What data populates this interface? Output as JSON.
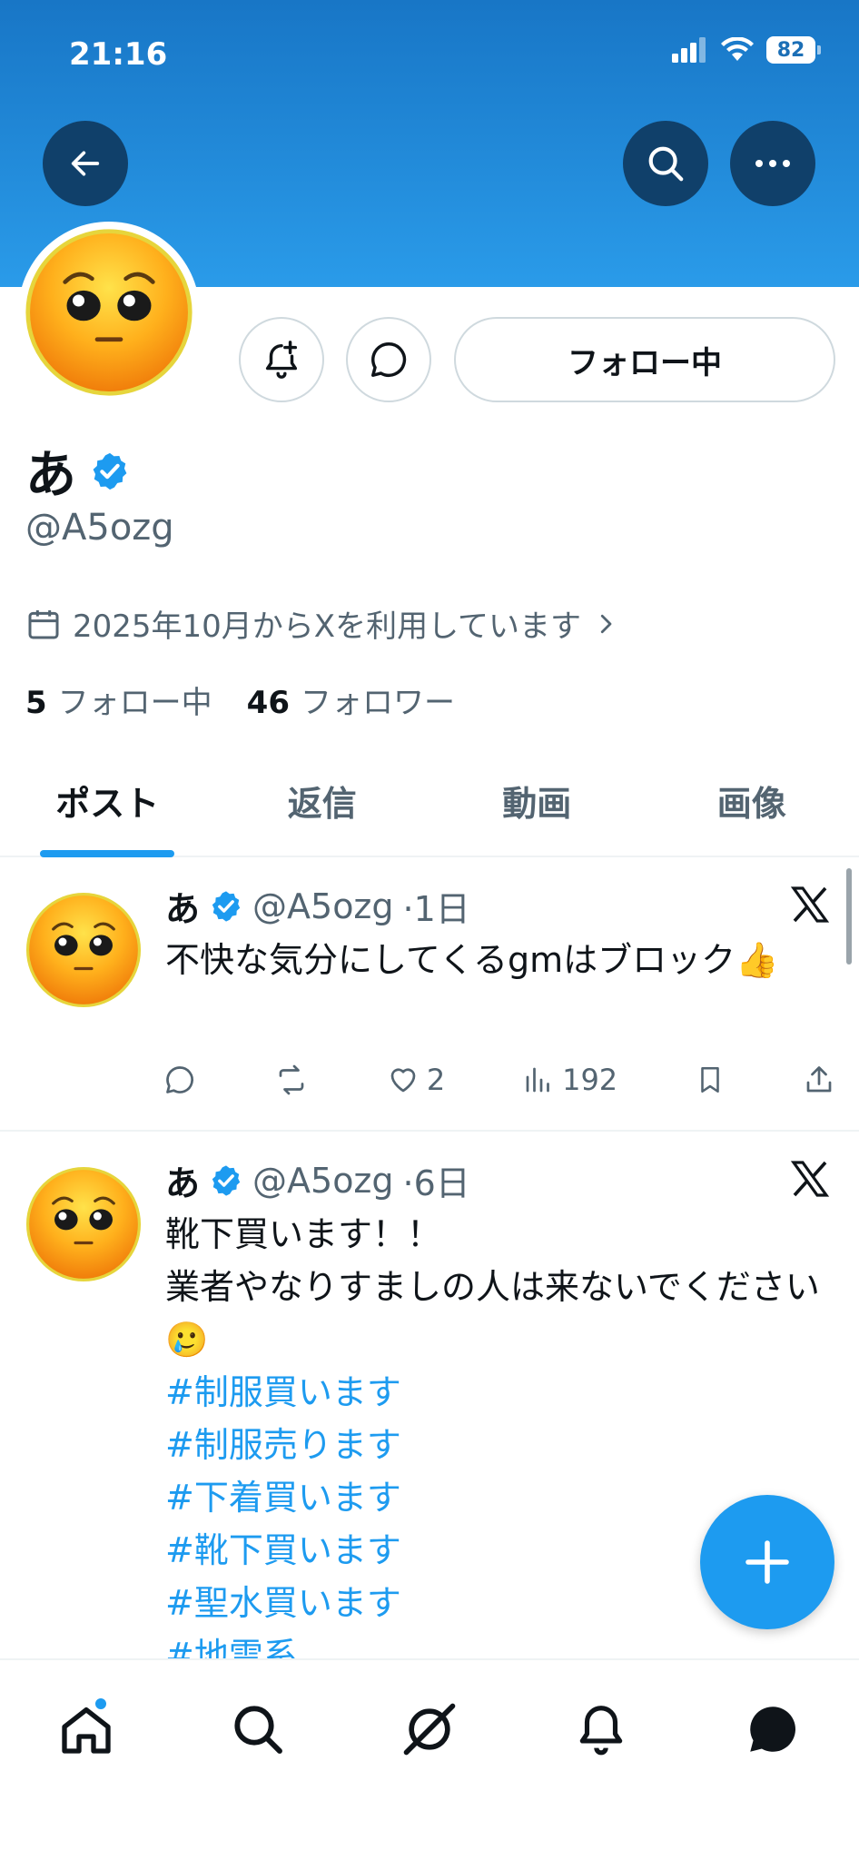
{
  "status_bar": {
    "time": "21:16",
    "battery": "82"
  },
  "header": {
    "back_icon": "arrow-left-icon",
    "search_icon": "search-icon",
    "more_icon": "more-horizontal-icon"
  },
  "profile": {
    "display_name": "あ",
    "verified": true,
    "handle": "@A5ozg",
    "joined": "2025年10月からXを利用しています",
    "following_count": "5",
    "following_label": "フォロー中",
    "followers_count": "46",
    "followers_label": "フォロワー",
    "follow_button": "フォロー中"
  },
  "tabs": [
    {
      "label": "ポスト",
      "active": true
    },
    {
      "label": "返信",
      "active": false
    },
    {
      "label": "動画",
      "active": false
    },
    {
      "label": "画像",
      "active": false
    }
  ],
  "posts": [
    {
      "name": "あ",
      "handle": "@A5ozg",
      "time": "·1日",
      "text": "不快な気分にしてくるgmはブロック👍",
      "likes": "2",
      "views": "192"
    },
    {
      "name": "あ",
      "handle": "@A5ozg",
      "time": "·6日",
      "line1": "靴下買います！！",
      "line2": "業者やなりすましの人は来ないでください🥲",
      "hashtags": [
        "#制服買います",
        "#制服売ります",
        "#下着買います",
        "#靴下買います",
        "#聖水買います",
        "#地雷系"
      ]
    }
  ],
  "colors": {
    "accent": "#1d9bf0",
    "header_top": "#1876c6",
    "header_bottom": "#2a9be9",
    "secondary_text": "#536471"
  }
}
